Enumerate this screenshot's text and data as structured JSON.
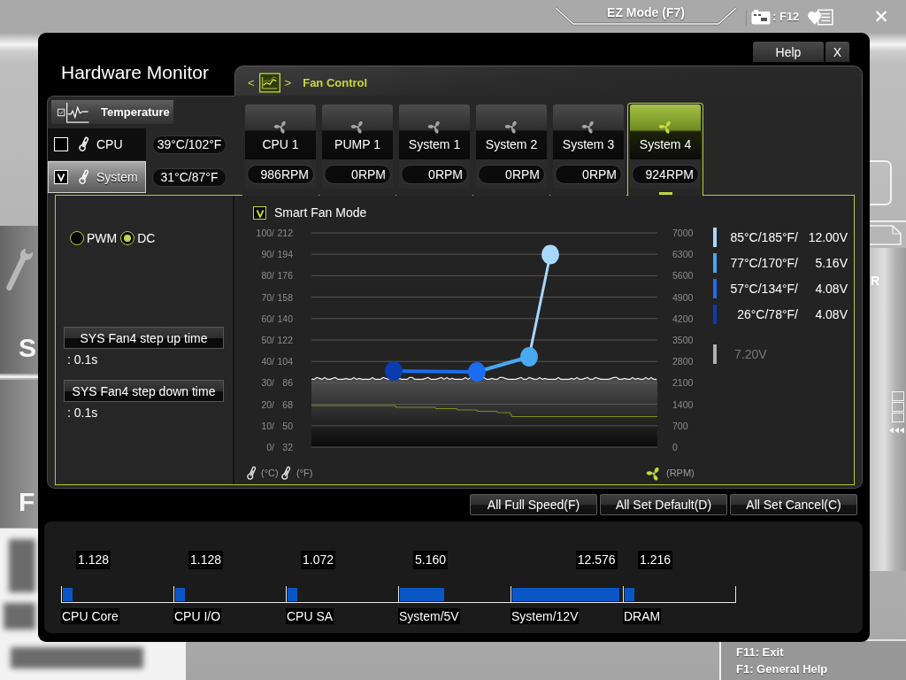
{
  "top_bar": {
    "mode_button": "EZ Mode (F7)",
    "screenshot_key": ": F12",
    "close": "✕"
  },
  "background": {
    "left_tiles": [
      {
        "label": "S"
      },
      {
        "label": "F"
      }
    ],
    "side_label": "R",
    "help_lines": [
      "F11: Exit",
      "F1: General Help"
    ]
  },
  "window": {
    "title": "Hardware Monitor",
    "buttons": [
      {
        "label": "Help",
        "kind": "help"
      },
      {
        "label": "X",
        "kind": "close"
      }
    ]
  },
  "temperature": {
    "title": "Temperature",
    "sensors": [
      {
        "name": "CPU",
        "reading": "39°C/102°F",
        "checked": false,
        "selected": false
      },
      {
        "name": "System",
        "reading": "31°C/87°F",
        "checked": true,
        "selected": true
      }
    ]
  },
  "fan_control": {
    "title": "Fan Control",
    "prev": "<",
    "next": ">",
    "fans": [
      {
        "name": "CPU 1",
        "rpm": "986RPM",
        "selected": false
      },
      {
        "name": "PUMP 1",
        "rpm": "0RPM",
        "selected": false
      },
      {
        "name": "System 1",
        "rpm": "0RPM",
        "selected": false
      },
      {
        "name": "System 2",
        "rpm": "0RPM",
        "selected": false
      },
      {
        "name": "System 3",
        "rpm": "0RPM",
        "selected": false
      },
      {
        "name": "System 4",
        "rpm": "924RPM",
        "selected": true
      }
    ],
    "modes": [
      {
        "label": "PWM",
        "selected": false
      },
      {
        "label": "DC",
        "selected": true
      }
    ],
    "step_times": [
      {
        "label": "SYS Fan4 step up time",
        "value": ": 0.1s"
      },
      {
        "label": "SYS Fan4 step down time",
        "value": ": 0.1s"
      }
    ],
    "smart_fan_mode": {
      "label": "Smart Fan Mode",
      "checked": true
    },
    "graph": {
      "celsius_ticks": [
        "100/",
        "90/",
        "80/",
        "70/",
        "60/",
        "50/",
        "40/",
        "30/",
        "20/",
        "10/",
        "0/"
      ],
      "fahrenheit_ticks": [
        "212",
        "194",
        "176",
        "158",
        "140",
        "122",
        "104",
        "86",
        "68",
        "50",
        "32"
      ],
      "rpm_ticks": [
        "7000",
        "6300",
        "5600",
        "4900",
        "4200",
        "3500",
        "2800",
        "2100",
        "1400",
        "700",
        "0"
      ],
      "units": [
        "(°C)",
        "(°F)",
        "(RPM)"
      ]
    },
    "curve_points": [
      {
        "temperature": "85°C/185°F/",
        "voltage": "12.00V",
        "color": "#a8d8ff"
      },
      {
        "temperature": "77°C/170°F/",
        "voltage": "5.16V",
        "color": "#48a8f0"
      },
      {
        "temperature": "57°C/134°F/",
        "voltage": "4.08V",
        "color": "#1c6cf0"
      },
      {
        "temperature": "26°C/78°F/",
        "voltage": "4.08V",
        "color": "#0a3cb0"
      }
    ],
    "current_voltage": {
      "value": "7.20V",
      "color": "#b0b0b0"
    }
  },
  "actions": [
    "All Full Speed(F)",
    "All Set Default(D)",
    "All Set Cancel(C)"
  ],
  "voltages": [
    {
      "value": "1.128",
      "label": "CPU Core",
      "level": 0.09
    },
    {
      "value": "1.128",
      "label": "CPU I/O",
      "level": 0.09
    },
    {
      "value": "1.072",
      "label": "CPU SA",
      "level": 0.09
    },
    {
      "value": "5.160",
      "label": "System/5V",
      "level": 0.39
    },
    {
      "value": "12.576",
      "label": "System/12V",
      "level": 0.95
    },
    {
      "value": "1.216",
      "label": "DRAM",
      "level": 0.09
    }
  ]
}
